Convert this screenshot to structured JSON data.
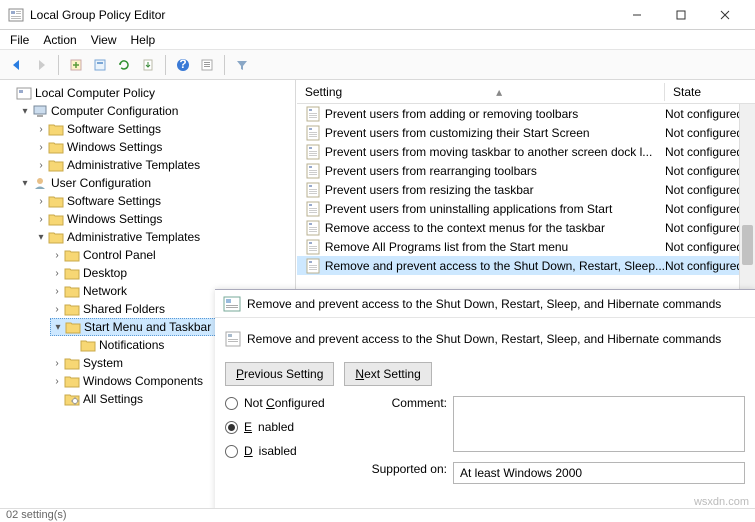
{
  "window": {
    "title": "Local Group Policy Editor",
    "menu": [
      "File",
      "Action",
      "View",
      "Help"
    ]
  },
  "tree": {
    "root": "Local Computer Policy",
    "cc": "Computer Configuration",
    "cc_items": [
      "Software Settings",
      "Windows Settings",
      "Administrative Templates"
    ],
    "uc": "User Configuration",
    "uc_items": [
      "Software Settings",
      "Windows Settings"
    ],
    "uc_at": "Administrative Templates",
    "at_children": [
      "Control Panel",
      "Desktop",
      "Network",
      "Shared Folders"
    ],
    "smt": "Start Menu and Taskbar",
    "smt_children": [
      "Notifications"
    ],
    "at_rest": [
      "System",
      "Windows Components",
      "All Settings"
    ]
  },
  "list": {
    "col_setting": "Setting",
    "col_state": "State",
    "items": [
      {
        "t": "Prevent users from adding or removing toolbars",
        "s": "Not configured"
      },
      {
        "t": "Prevent users from customizing their Start Screen",
        "s": "Not configured"
      },
      {
        "t": "Prevent users from moving taskbar to another screen dock l...",
        "s": "Not configured"
      },
      {
        "t": "Prevent users from rearranging toolbars",
        "s": "Not configured"
      },
      {
        "t": "Prevent users from resizing the taskbar",
        "s": "Not configured"
      },
      {
        "t": "Prevent users from uninstalling applications from Start",
        "s": "Not configured"
      },
      {
        "t": "Remove access to the context menus for the taskbar",
        "s": "Not configured"
      },
      {
        "t": "Remove All Programs list from the Start menu",
        "s": "Not configured"
      },
      {
        "t": "Remove and prevent access to the Shut Down, Restart, Sleep...",
        "s": "Not configured",
        "sel": true
      }
    ]
  },
  "dialog": {
    "title": "Remove and prevent access to the Shut Down, Restart, Sleep, and Hibernate commands",
    "heading": "Remove and prevent access to the Shut Down, Restart, Sleep, and Hibernate commands",
    "prev": "Previous Setting",
    "next": "Next Setting",
    "radios": {
      "notconf": "Not Configured",
      "enabled": "Enabled",
      "disabled": "Disabled"
    },
    "comment_label": "Comment:",
    "supported_label": "Supported on:",
    "supported_value": "At least Windows 2000"
  },
  "status": "02 setting(s)",
  "watermark": "wsxdn.com"
}
